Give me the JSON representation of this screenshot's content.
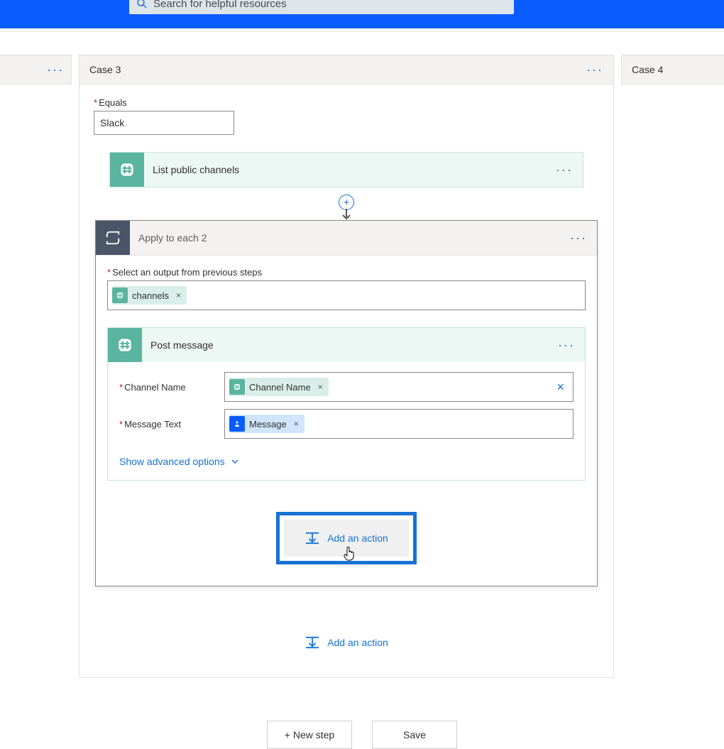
{
  "topbar": {
    "search_placeholder": "Search for helpful resources"
  },
  "cases": {
    "left_ellipsis": "···",
    "main_title": "Case 3",
    "main_ellipsis": "···",
    "right_title": "Case 4"
  },
  "equals": {
    "label": "Equals",
    "value": "Slack"
  },
  "list_channels": {
    "title": "List public channels",
    "ellipsis": "···"
  },
  "apply": {
    "title": "Apply to each 2",
    "ellipsis": "···",
    "select_label": "Select an output from previous steps",
    "token_label": "channels"
  },
  "post": {
    "title": "Post message",
    "ellipsis": "···",
    "channel_label": "Channel Name",
    "channel_token": "Channel Name",
    "message_label": "Message Text",
    "message_token": "Message",
    "advanced": "Show advanced options"
  },
  "actions": {
    "add_inner": "Add an action",
    "add_outer": "Add an action",
    "new_step": "+ New step",
    "save": "Save"
  },
  "colors": {
    "accent": "#1672d3",
    "slack": "#59b5a0",
    "apply": "#4a5568",
    "topbar": "#0a5cff"
  }
}
